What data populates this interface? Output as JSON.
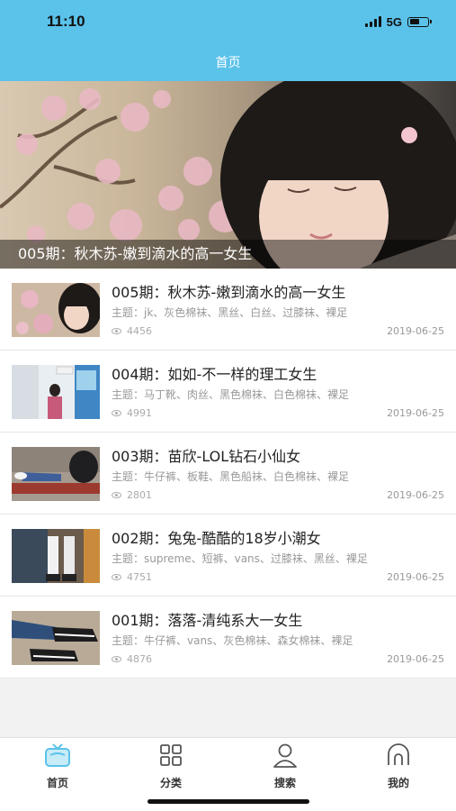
{
  "status_bar": {
    "time": "11:10",
    "network": "5G",
    "battery_level": 0.55
  },
  "nav": {
    "title": "首页"
  },
  "banner": {
    "caption": "005期：秋木苏-嫩到滴水的高一女生"
  },
  "items": [
    {
      "title": "005期：秋木苏-嫩到滴水的高一女生",
      "tags": "主题：jk、灰色棉袜、黑丝、白丝、过膝袜、裸足",
      "views": "4456",
      "date": "2019-06-25"
    },
    {
      "title": "004期：如如-不一样的理工女生",
      "tags": "主题：马丁靴、肉丝、黑色棉袜、白色棉袜、裸足",
      "views": "4991",
      "date": "2019-06-25"
    },
    {
      "title": "003期：苗欣-LOL钻石小仙女",
      "tags": "主题：牛仔裤、板鞋、黑色船袜、白色棉袜、裸足",
      "views": "2801",
      "date": "2019-06-25"
    },
    {
      "title": "002期：兔兔-酷酷的18岁小潮女",
      "tags": "主题：supreme、短裤、vans、过膝袜、黑丝、裸足",
      "views": "4751",
      "date": "2019-06-25"
    },
    {
      "title": "001期：落落-清纯系大一女生",
      "tags": "主题：牛仔裤、vans、灰色棉袜、森女棉袜、裸足",
      "views": "4876",
      "date": "2019-06-25"
    }
  ],
  "tabbar": {
    "tabs": [
      {
        "label": "首页",
        "icon": "tv-icon",
        "active": true
      },
      {
        "label": "分类",
        "icon": "grid-icon",
        "active": false
      },
      {
        "label": "搜索",
        "icon": "user-search-icon",
        "active": false
      },
      {
        "label": "我的",
        "icon": "profile-icon",
        "active": false
      }
    ]
  },
  "colors": {
    "header": "#5bc2ea",
    "accent": "#5bc2ea",
    "background": "#f2f2f2"
  }
}
